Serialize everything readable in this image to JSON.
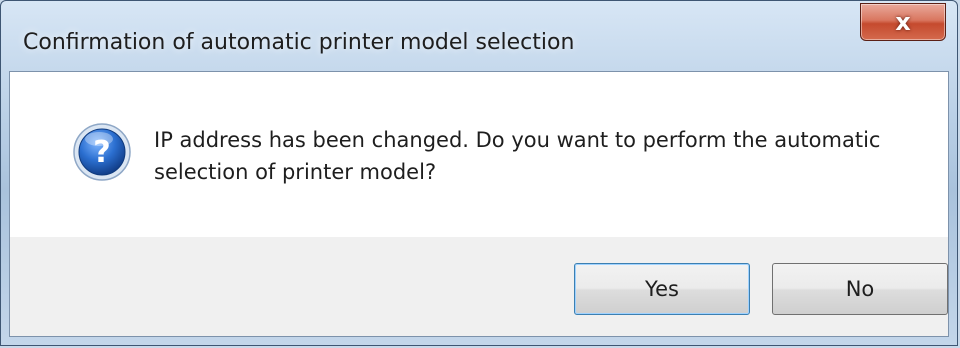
{
  "dialog": {
    "title": "Confirmation of automatic printer model selection",
    "close_label": "x",
    "icon": "question-icon",
    "message": "IP address has been changed. Do you want to perform the automatic selection of printer model?",
    "buttons": {
      "yes_label": "Yes",
      "no_label": "No"
    }
  },
  "colors": {
    "close_button": "#c54a2e",
    "icon_blue": "#1f5fb5",
    "button_focus_border": "#3c7fb1"
  }
}
